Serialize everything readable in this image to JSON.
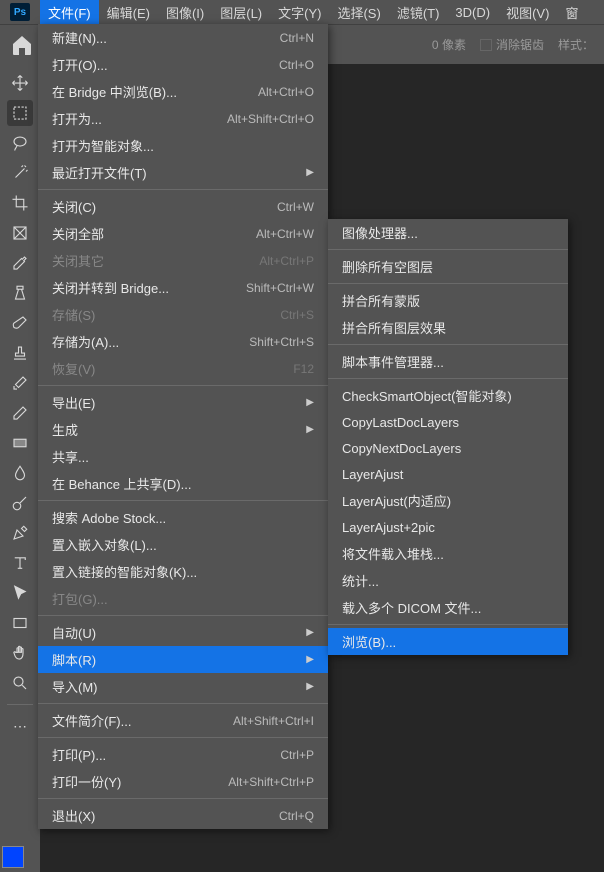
{
  "menubar": {
    "logo": "Ps",
    "items": [
      "文件(F)",
      "编辑(E)",
      "图像(I)",
      "图层(L)",
      "文字(Y)",
      "选择(S)",
      "滤镜(T)",
      "3D(D)",
      "视图(V)",
      "窗"
    ]
  },
  "options": {
    "value": "0",
    "unit": "像素",
    "antialias": "消除锯齿",
    "style_label": "样式："
  },
  "file_menu": [
    {
      "label": "新建(N)...",
      "shortcut": "Ctrl+N"
    },
    {
      "label": "打开(O)...",
      "shortcut": "Ctrl+O"
    },
    {
      "label": "在 Bridge 中浏览(B)...",
      "shortcut": "Alt+Ctrl+O"
    },
    {
      "label": "打开为...",
      "shortcut": "Alt+Shift+Ctrl+O"
    },
    {
      "label": "打开为智能对象..."
    },
    {
      "label": "最近打开文件(T)",
      "submenu": true
    },
    {
      "sep": true
    },
    {
      "label": "关闭(C)",
      "shortcut": "Ctrl+W"
    },
    {
      "label": "关闭全部",
      "shortcut": "Alt+Ctrl+W"
    },
    {
      "label": "关闭其它",
      "shortcut": "Alt+Ctrl+P",
      "disabled": true
    },
    {
      "label": "关闭并转到 Bridge...",
      "shortcut": "Shift+Ctrl+W"
    },
    {
      "label": "存储(S)",
      "shortcut": "Ctrl+S",
      "disabled": true
    },
    {
      "label": "存储为(A)...",
      "shortcut": "Shift+Ctrl+S"
    },
    {
      "label": "恢复(V)",
      "shortcut": "F12",
      "disabled": true
    },
    {
      "sep": true
    },
    {
      "label": "导出(E)",
      "submenu": true
    },
    {
      "label": "生成",
      "submenu": true
    },
    {
      "label": "共享..."
    },
    {
      "label": "在 Behance 上共享(D)..."
    },
    {
      "sep": true
    },
    {
      "label": "搜索 Adobe Stock..."
    },
    {
      "label": "置入嵌入对象(L)..."
    },
    {
      "label": "置入链接的智能对象(K)..."
    },
    {
      "label": "打包(G)...",
      "disabled": true
    },
    {
      "sep": true
    },
    {
      "label": "自动(U)",
      "submenu": true
    },
    {
      "label": "脚本(R)",
      "submenu": true,
      "highlighted": true
    },
    {
      "label": "导入(M)",
      "submenu": true
    },
    {
      "sep": true
    },
    {
      "label": "文件简介(F)...",
      "shortcut": "Alt+Shift+Ctrl+I"
    },
    {
      "sep": true
    },
    {
      "label": "打印(P)...",
      "shortcut": "Ctrl+P"
    },
    {
      "label": "打印一份(Y)",
      "shortcut": "Alt+Shift+Ctrl+P"
    },
    {
      "sep": true
    },
    {
      "label": "退出(X)",
      "shortcut": "Ctrl+Q"
    }
  ],
  "scripts_menu": [
    {
      "label": "图像处理器..."
    },
    {
      "sep": true
    },
    {
      "label": "删除所有空图层"
    },
    {
      "sep": true
    },
    {
      "label": "拼合所有蒙版"
    },
    {
      "label": "拼合所有图层效果"
    },
    {
      "sep": true
    },
    {
      "label": "脚本事件管理器..."
    },
    {
      "sep": true
    },
    {
      "label": "CheckSmartObject(智能对象)"
    },
    {
      "label": "CopyLastDocLayers"
    },
    {
      "label": "CopyNextDocLayers"
    },
    {
      "label": "LayerAjust"
    },
    {
      "label": "LayerAjust(内适应)"
    },
    {
      "label": "LayerAjust+2pic"
    },
    {
      "label": "将文件载入堆栈..."
    },
    {
      "label": "统计..."
    },
    {
      "label": "载入多个 DICOM 文件..."
    },
    {
      "sep": true
    },
    {
      "label": "浏览(B)...",
      "highlighted": true
    }
  ]
}
